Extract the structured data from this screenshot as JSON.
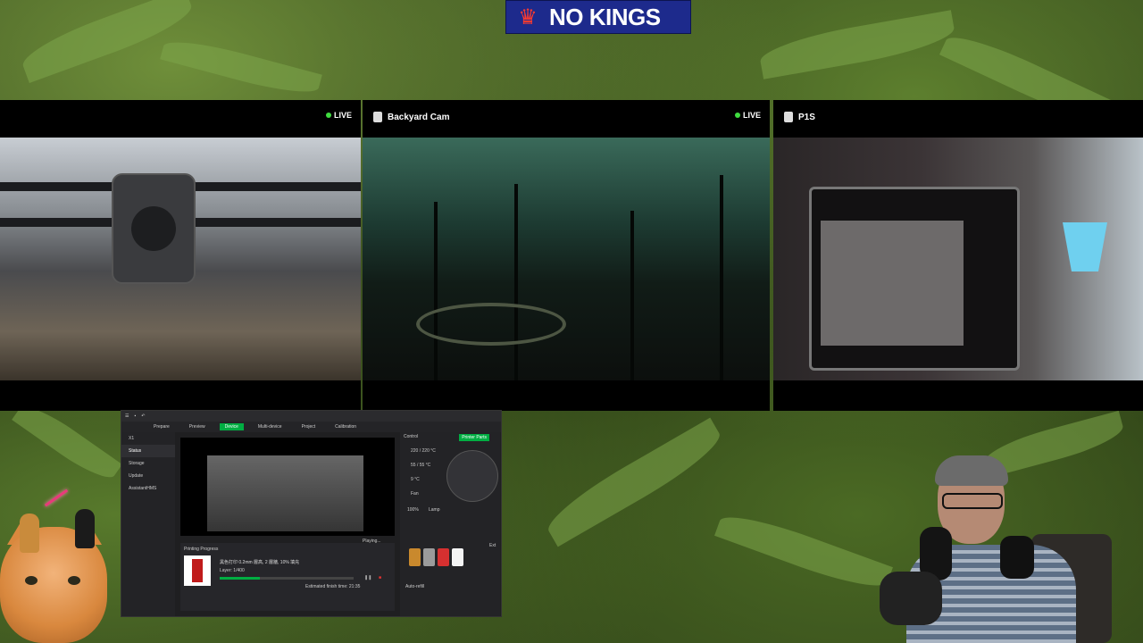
{
  "banner": {
    "text": "NO KINGS",
    "crown_icon": "crown-icon"
  },
  "cameras": [
    {
      "name": "",
      "live_label": "LIVE"
    },
    {
      "name": "Backyard Cam",
      "live_label": "LIVE"
    },
    {
      "name": "P1S",
      "live_label": ""
    }
  ],
  "app": {
    "tabs": [
      "Prepare",
      "Preview",
      "Device",
      "Multi-device",
      "Project",
      "Calibration"
    ],
    "active_tab": "Device",
    "printer_name": "X1",
    "sidebar": [
      "Status",
      "Storage",
      "Update",
      "AssistantHMS"
    ],
    "playing_label": "Playing...",
    "printing_progress_label": "Printing Progress",
    "job_text": "黑色打印 0.2mm 層高, 2 層牆, 10% 填充",
    "layer_label": "Layer: 1/400",
    "estimated_label": "Estimated finish time: 21:35",
    "control_label": "Control",
    "printer_parts_label": "Printer Parts",
    "nozzle_temp": "220 / 220 °C",
    "bed_temp": "55 / 55 °C",
    "chamber_temp": "9 °C",
    "fan_label": "Fan",
    "speed_label": "Lamp",
    "percent": "100%",
    "progress_fraction": 0.3,
    "auto_refill": "Auto-refill",
    "ext_label": "Ext",
    "ams_colors": [
      "#c9892d",
      "#9b9b9b",
      "#d63030",
      "#f4f4f4"
    ]
  }
}
